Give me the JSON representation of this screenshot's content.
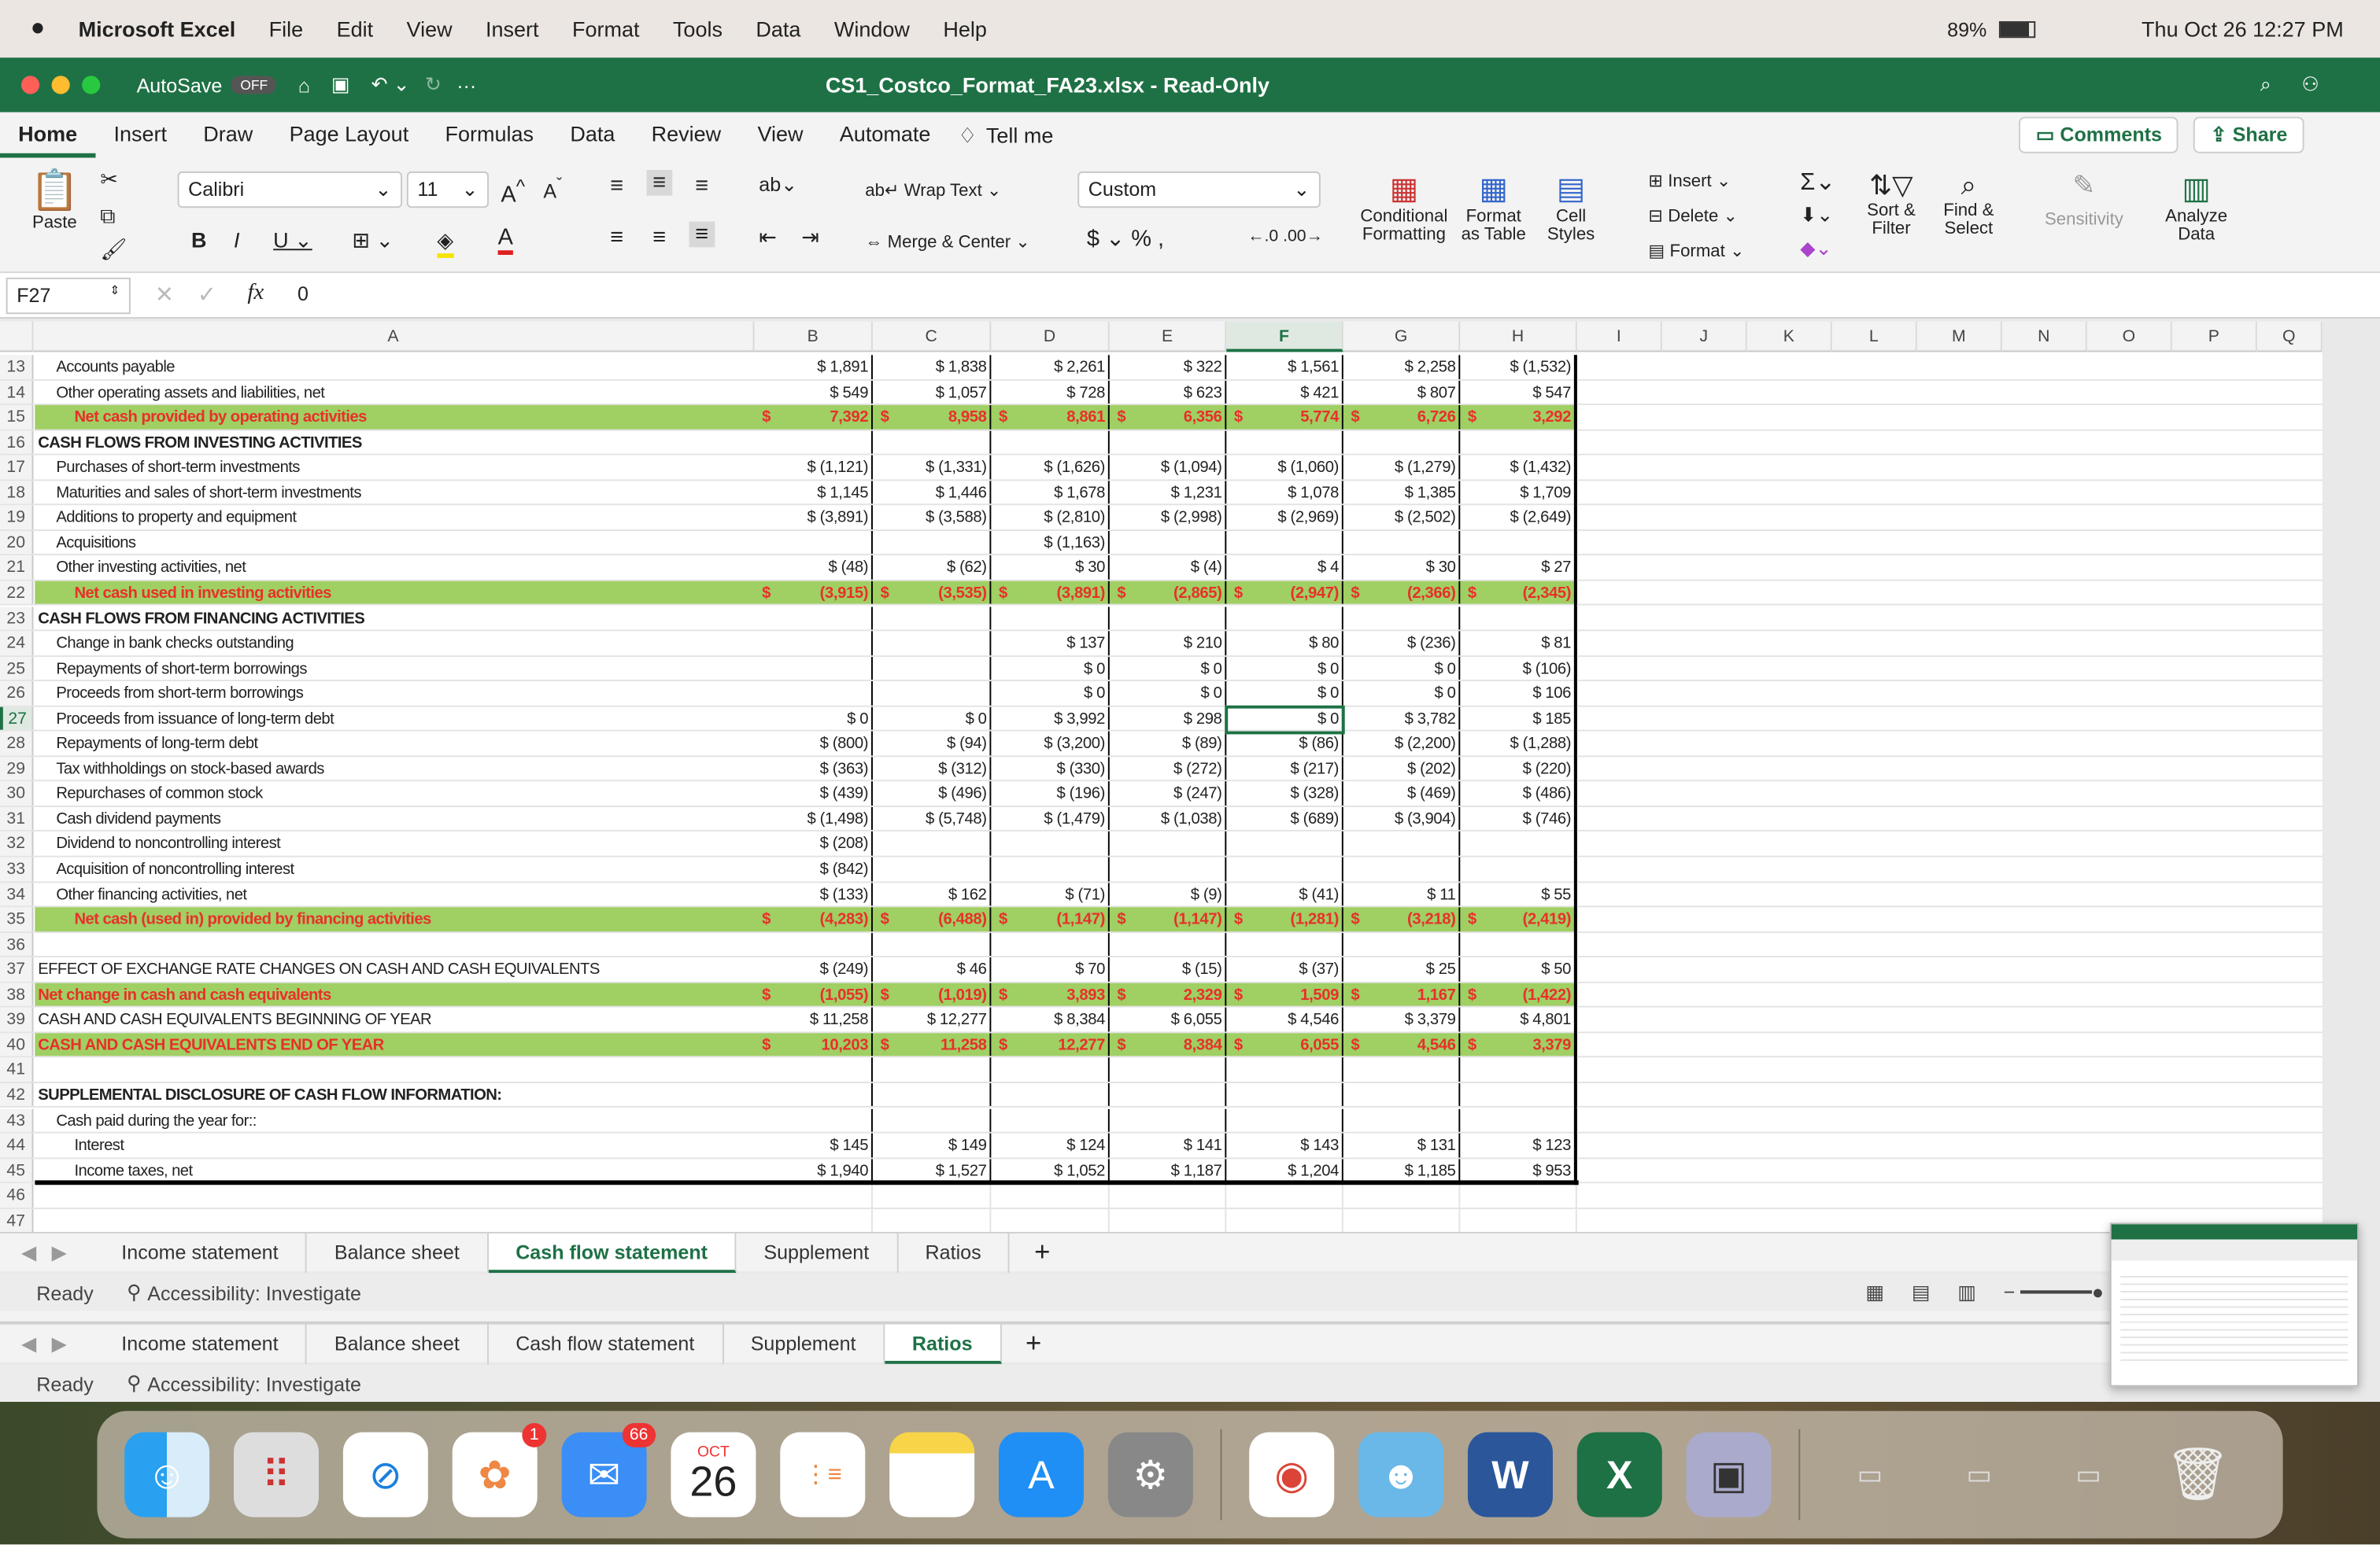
{
  "menubar": {
    "app": "Microsoft Excel",
    "items": [
      "File",
      "Edit",
      "View",
      "Insert",
      "Format",
      "Tools",
      "Data",
      "Window",
      "Help"
    ],
    "battery": "89%",
    "datetime": "Thu Oct 26  12:27 PM"
  },
  "titlebar": {
    "autosave": "AutoSave",
    "autosave_state": "OFF",
    "title": "CS1_Costco_Format_FA23.xlsx  -  Read-Only"
  },
  "ribbon_tabs": [
    "Home",
    "Insert",
    "Draw",
    "Page Layout",
    "Formulas",
    "Data",
    "Review",
    "View",
    "Automate"
  ],
  "tell_me": "Tell me",
  "comments": "Comments",
  "share": "Share",
  "ribbon": {
    "paste": "Paste",
    "font": "Calibri",
    "size": "11",
    "wrap": "Wrap Text",
    "merge": "Merge & Center",
    "number_format": "Custom",
    "cond": "Conditional Formatting",
    "fmt_table": "Format as Table",
    "cell_styles": "Cell Styles",
    "insert": "Insert",
    "delete": "Delete",
    "format": "Format",
    "sort": "Sort & Filter",
    "find": "Find & Select",
    "sensitivity": "Sensitivity",
    "analyze": "Analyze Data"
  },
  "formula_bar": {
    "name_box": "F27",
    "fx": "fx",
    "value": "0"
  },
  "columns": [
    "A",
    "B",
    "C",
    "D",
    "E",
    "F",
    "G",
    "H",
    "I",
    "J",
    "K",
    "L",
    "M",
    "N",
    "O",
    "P",
    "Q"
  ],
  "rows": [
    {
      "n": "13",
      "label": "Accounts payable",
      "indent": 1,
      "type": "",
      "v": [
        "$ 1,891",
        "$ 1,838",
        "$ 2,261",
        "$ 322",
        "$ 1,561",
        "$ 2,258",
        "$ (1,532)"
      ]
    },
    {
      "n": "14",
      "label": "Other operating assets and liabilities, net",
      "indent": 1,
      "type": "",
      "v": [
        "$ 549",
        "$ 1,057",
        "$ 728",
        "$ 623",
        "$ 421",
        "$ 807",
        "$ 547"
      ]
    },
    {
      "n": "15",
      "label": "Net cash provided by operating activities",
      "indent": 2,
      "type": "total",
      "v": [
        "7,392",
        "8,958",
        "8,861",
        "6,356",
        "5,774",
        "6,726",
        "3,292"
      ]
    },
    {
      "n": "16",
      "label": "CASH FLOWS FROM INVESTING ACTIVITIES",
      "indent": 0,
      "type": "section",
      "v": [
        "",
        "",
        "",
        "",
        "",
        "",
        ""
      ]
    },
    {
      "n": "17",
      "label": "Purchases of short-term investments",
      "indent": 1,
      "type": "",
      "v": [
        "$ (1,121)",
        "$ (1,331)",
        "$ (1,626)",
        "$ (1,094)",
        "$ (1,060)",
        "$ (1,279)",
        "$ (1,432)"
      ]
    },
    {
      "n": "18",
      "label": "Maturities and sales of short-term investments",
      "indent": 1,
      "type": "",
      "v": [
        "$ 1,145",
        "$ 1,446",
        "$ 1,678",
        "$ 1,231",
        "$ 1,078",
        "$ 1,385",
        "$ 1,709"
      ]
    },
    {
      "n": "19",
      "label": "Additions to property and equipment",
      "indent": 1,
      "type": "",
      "v": [
        "$ (3,891)",
        "$ (3,588)",
        "$ (2,810)",
        "$ (2,998)",
        "$ (2,969)",
        "$ (2,502)",
        "$ (2,649)"
      ]
    },
    {
      "n": "20",
      "label": "Acquisitions",
      "indent": 1,
      "type": "",
      "v": [
        "",
        "",
        "$ (1,163)",
        "",
        "",
        "",
        ""
      ]
    },
    {
      "n": "21",
      "label": "Other investing activities, net",
      "indent": 1,
      "type": "",
      "v": [
        "$ (48)",
        "$ (62)",
        "$ 30",
        "$ (4)",
        "$ 4",
        "$ 30",
        "$ 27"
      ]
    },
    {
      "n": "22",
      "label": "Net cash used in investing activities",
      "indent": 2,
      "type": "total",
      "v": [
        "(3,915)",
        "(3,535)",
        "(3,891)",
        "(2,865)",
        "(2,947)",
        "(2,366)",
        "(2,345)"
      ]
    },
    {
      "n": "23",
      "label": "CASH FLOWS FROM FINANCING ACTIVITIES",
      "indent": 0,
      "type": "section",
      "v": [
        "",
        "",
        "",
        "",
        "",
        "",
        ""
      ]
    },
    {
      "n": "24",
      "label": "Change in bank checks outstanding",
      "indent": 1,
      "type": "",
      "v": [
        "",
        "",
        "$ 137",
        "$ 210",
        "$ 80",
        "$ (236)",
        "$ 81"
      ]
    },
    {
      "n": "25",
      "label": "Repayments of short-term borrowings",
      "indent": 1,
      "type": "",
      "v": [
        "",
        "",
        "$ 0",
        "$ 0",
        "$ 0",
        "$ 0",
        "$ (106)"
      ]
    },
    {
      "n": "26",
      "label": "Proceeds from short-term borrowings",
      "indent": 1,
      "type": "",
      "v": [
        "",
        "",
        "$ 0",
        "$ 0",
        "$ 0",
        "$ 0",
        "$ 106"
      ]
    },
    {
      "n": "27",
      "label": "Proceeds from issuance of long-term debt",
      "indent": 1,
      "type": "",
      "v": [
        "$ 0",
        "$ 0",
        "$ 3,992",
        "$ 298",
        "$ 0",
        "$ 3,782",
        "$ 185"
      ]
    },
    {
      "n": "28",
      "label": "Repayments of long-term debt",
      "indent": 1,
      "type": "",
      "v": [
        "$ (800)",
        "$ (94)",
        "$ (3,200)",
        "$ (89)",
        "$ (86)",
        "$ (2,200)",
        "$ (1,288)"
      ]
    },
    {
      "n": "29",
      "label": "Tax withholdings on stock-based awards",
      "indent": 1,
      "type": "",
      "v": [
        "$ (363)",
        "$ (312)",
        "$ (330)",
        "$ (272)",
        "$ (217)",
        "$ (202)",
        "$ (220)"
      ]
    },
    {
      "n": "30",
      "label": "Repurchases of common stock",
      "indent": 1,
      "type": "",
      "v": [
        "$ (439)",
        "$ (496)",
        "$ (196)",
        "$ (247)",
        "$ (328)",
        "$ (469)",
        "$ (486)"
      ]
    },
    {
      "n": "31",
      "label": "Cash dividend payments",
      "indent": 1,
      "type": "",
      "v": [
        "$ (1,498)",
        "$ (5,748)",
        "$ (1,479)",
        "$ (1,038)",
        "$ (689)",
        "$ (3,904)",
        "$ (746)"
      ]
    },
    {
      "n": "32",
      "label": "Dividend to noncontrolling interest",
      "indent": 1,
      "type": "",
      "v": [
        "$ (208)",
        "",
        "",
        "",
        "",
        "",
        ""
      ]
    },
    {
      "n": "33",
      "label": "Acquisition of noncontrolling interest",
      "indent": 1,
      "type": "",
      "v": [
        "$ (842)",
        "",
        "",
        "",
        "",
        "",
        ""
      ]
    },
    {
      "n": "34",
      "label": "Other financing activities, net",
      "indent": 1,
      "type": "",
      "v": [
        "$ (133)",
        "$ 162",
        "$ (71)",
        "$ (9)",
        "$ (41)",
        "$ 11",
        "$ 55"
      ]
    },
    {
      "n": "35",
      "label": "Net cash (used in) provided by financing activities",
      "indent": 2,
      "type": "total",
      "v": [
        "(4,283)",
        "(6,488)",
        "(1,147)",
        "(1,147)",
        "(1,281)",
        "(3,218)",
        "(2,419)"
      ]
    },
    {
      "n": "36",
      "label": "",
      "indent": 0,
      "type": "",
      "v": [
        "",
        "",
        "",
        "",
        "",
        "",
        ""
      ]
    },
    {
      "n": "37",
      "label": "EFFECT OF EXCHANGE RATE CHANGES ON CASH AND CASH EQUIVALENTS",
      "indent": 0,
      "type": "",
      "v": [
        "$ (249)",
        "$ 46",
        "$ 70",
        "$ (15)",
        "$ (37)",
        "$ 25",
        "$ 50"
      ]
    },
    {
      "n": "38",
      "label": "Net change in cash and cash equivalents",
      "indent": 0,
      "type": "total",
      "v": [
        "(1,055)",
        "(1,019)",
        "3,893",
        "2,329",
        "1,509",
        "1,167",
        "(1,422)"
      ]
    },
    {
      "n": "39",
      "label": "CASH AND CASH EQUIVALENTS BEGINNING OF YEAR",
      "indent": 0,
      "type": "",
      "v": [
        "$ 11,258",
        "$ 12,277",
        "$ 8,384",
        "$ 6,055",
        "$ 4,546",
        "$ 3,379",
        "$ 4,801"
      ]
    },
    {
      "n": "40",
      "label": "CASH AND CASH EQUIVALENTS END OF YEAR",
      "indent": 0,
      "type": "total",
      "v": [
        "10,203",
        "11,258",
        "12,277",
        "8,384",
        "6,055",
        "4,546",
        "3,379"
      ]
    },
    {
      "n": "41",
      "label": "",
      "indent": 0,
      "type": "",
      "v": [
        "",
        "",
        "",
        "",
        "",
        "",
        ""
      ]
    },
    {
      "n": "42",
      "label": "SUPPLEMENTAL DISCLOSURE OF CASH FLOW INFORMATION:",
      "indent": 0,
      "type": "section",
      "v": [
        "",
        "",
        "",
        "",
        "",
        "",
        ""
      ]
    },
    {
      "n": "43",
      "label": "Cash paid during the year for::",
      "indent": 1,
      "type": "",
      "v": [
        "",
        "",
        "",
        "",
        "",
        "",
        ""
      ]
    },
    {
      "n": "44",
      "label": "Interest",
      "indent": 2,
      "type": "",
      "v": [
        "$ 145",
        "$ 149",
        "$ 124",
        "$ 141",
        "$ 143",
        "$ 131",
        "$ 123"
      ]
    },
    {
      "n": "45",
      "label": "Income taxes, net",
      "indent": 2,
      "type": "",
      "v": [
        "$ 1,940",
        "$ 1,527",
        "$ 1,052",
        "$ 1,187",
        "$ 1,204",
        "$ 1,185",
        "$ 953"
      ]
    },
    {
      "n": "46",
      "label": "",
      "indent": 0,
      "type": "",
      "v": [
        "",
        "",
        "",
        "",
        "",
        "",
        ""
      ]
    },
    {
      "n": "47",
      "label": "",
      "indent": 0,
      "type": "",
      "v": [
        "",
        "",
        "",
        "",
        "",
        "",
        ""
      ]
    }
  ],
  "total_currency": "$",
  "sheets_front": {
    "tabs": [
      "Income statement",
      "Balance sheet",
      "Cash flow statement",
      "Supplement",
      "Ratios"
    ],
    "active": 2
  },
  "sheets_back": {
    "tabs": [
      "Income statement",
      "Balance sheet",
      "Cash flow statement",
      "Supplement",
      "Ratios"
    ],
    "active": 4
  },
  "status": {
    "ready": "Ready",
    "accessibility": "Accessibility: Investigate"
  },
  "dock": {
    "mail_badge": "66",
    "photos_badge": "1",
    "calendar_month": "OCT",
    "calendar_day": "26"
  },
  "colors": {
    "excel_green": "#1e7145",
    "total_fill": "#a0cf63",
    "total_text": "#e8302a"
  }
}
